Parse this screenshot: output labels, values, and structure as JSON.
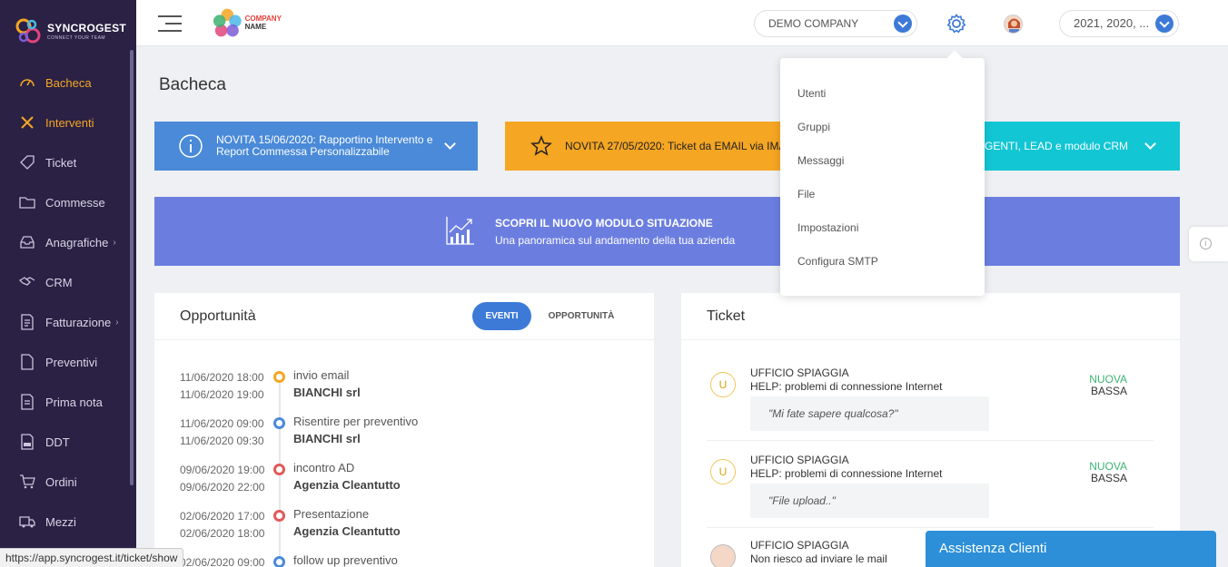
{
  "sidebar": {
    "brand": "SYNCROGEST",
    "tagline": "CONNECT YOUR TEAM",
    "items": [
      {
        "label": "Bacheca",
        "icon": "gauge-icon",
        "active": true
      },
      {
        "label": "Interventi",
        "icon": "wrench-icon",
        "active": true
      },
      {
        "label": "Ticket",
        "icon": "tag-icon"
      },
      {
        "label": "Commesse",
        "icon": "folder-icon"
      },
      {
        "label": "Anagrafiche",
        "icon": "inbox-icon",
        "has_children": true
      },
      {
        "label": "CRM",
        "icon": "handshake-icon"
      },
      {
        "label": "Fatturazione",
        "icon": "invoice-icon",
        "has_children": true
      },
      {
        "label": "Preventivi",
        "icon": "document-icon"
      },
      {
        "label": "Prima nota",
        "icon": "note-icon"
      },
      {
        "label": "DDT",
        "icon": "ddt-icon"
      },
      {
        "label": "Ordini",
        "icon": "cart-icon"
      },
      {
        "label": "Mezzi",
        "icon": "truck-icon"
      }
    ]
  },
  "topbar": {
    "company_logo_line1": "COMPANY",
    "company_logo_line2": "NAME",
    "company_select": "DEMO COMPANY",
    "year_select": "2021, 2020, ..."
  },
  "settings_menu": {
    "items": [
      "Utenti",
      "Gruppi",
      "Messaggi",
      "File",
      "Impostazioni",
      "Configura SMTP"
    ]
  },
  "main": {
    "title": "Bacheca",
    "banners": [
      {
        "text": "NOVITA 15/06/2020: Rapportino Intervento e Report Commessa Personalizzabile"
      },
      {
        "text": "NOVITA 27/05/2020: Ticket da EMAIL via IMA"
      },
      {
        "text": "AGENTI, LEAD e modulo CRM"
      }
    ],
    "promo": {
      "title": "SCOPRI IL NUOVO MODULO SITUAZIONE",
      "subtitle": "Una panoramica sul andamento della tua azienda"
    }
  },
  "opportunita": {
    "title": "Opportunità",
    "tab_eventi": "EVENTI",
    "tab_opportunita": "OPPORTUNITÀ",
    "events": [
      {
        "date1": "11/06/2020 18:00",
        "date2": "11/06/2020 19:00",
        "title": "invio email",
        "company": "BIANCHI srl",
        "color": "#f5a623"
      },
      {
        "date1": "11/06/2020 09:00",
        "date2": "11/06/2020 09:30",
        "title": "Risentire per preventivo",
        "company": "BIANCHI srl",
        "color": "#4a8ad8"
      },
      {
        "date1": "09/06/2020 19:00",
        "date2": "09/06/2020 22:00",
        "title": "incontro AD",
        "company": "Agenzia Cleantutto",
        "color": "#e05a5a"
      },
      {
        "date1": "02/06/2020 17:00",
        "date2": "02/06/2020 18:00",
        "title": "Presentazione",
        "company": "Agenzia Cleantutto",
        "color": "#e05a5a"
      },
      {
        "date1": "02/06/2020 09:00",
        "date2": "",
        "title": "follow up preventivo",
        "company": "",
        "color": "#4a8ad8"
      }
    ]
  },
  "ticket": {
    "title": "Ticket",
    "items": [
      {
        "badge": "U",
        "org": "UFFICIO SPIAGGIA",
        "title": "HELP: problemi di connessione Internet",
        "quote": "\"Mi fate sapere qualcosa?\"",
        "status": "NUOVA",
        "priority": "BASSA"
      },
      {
        "badge": "U",
        "org": "UFFICIO SPIAGGIA",
        "title": "HELP: problemi di connessione Internet",
        "quote": "\"File upload..\"",
        "status": "NUOVA",
        "priority": "BASSA"
      },
      {
        "badge": "",
        "org": "UFFICIO SPIAGGIA",
        "title": "Non riesco ad inviare le mail",
        "quote": "",
        "status": "",
        "priority": ""
      }
    ]
  },
  "status_url": "https://app.syncrogest.it/ticket/show",
  "assistance": "Assistenza Clienti"
}
